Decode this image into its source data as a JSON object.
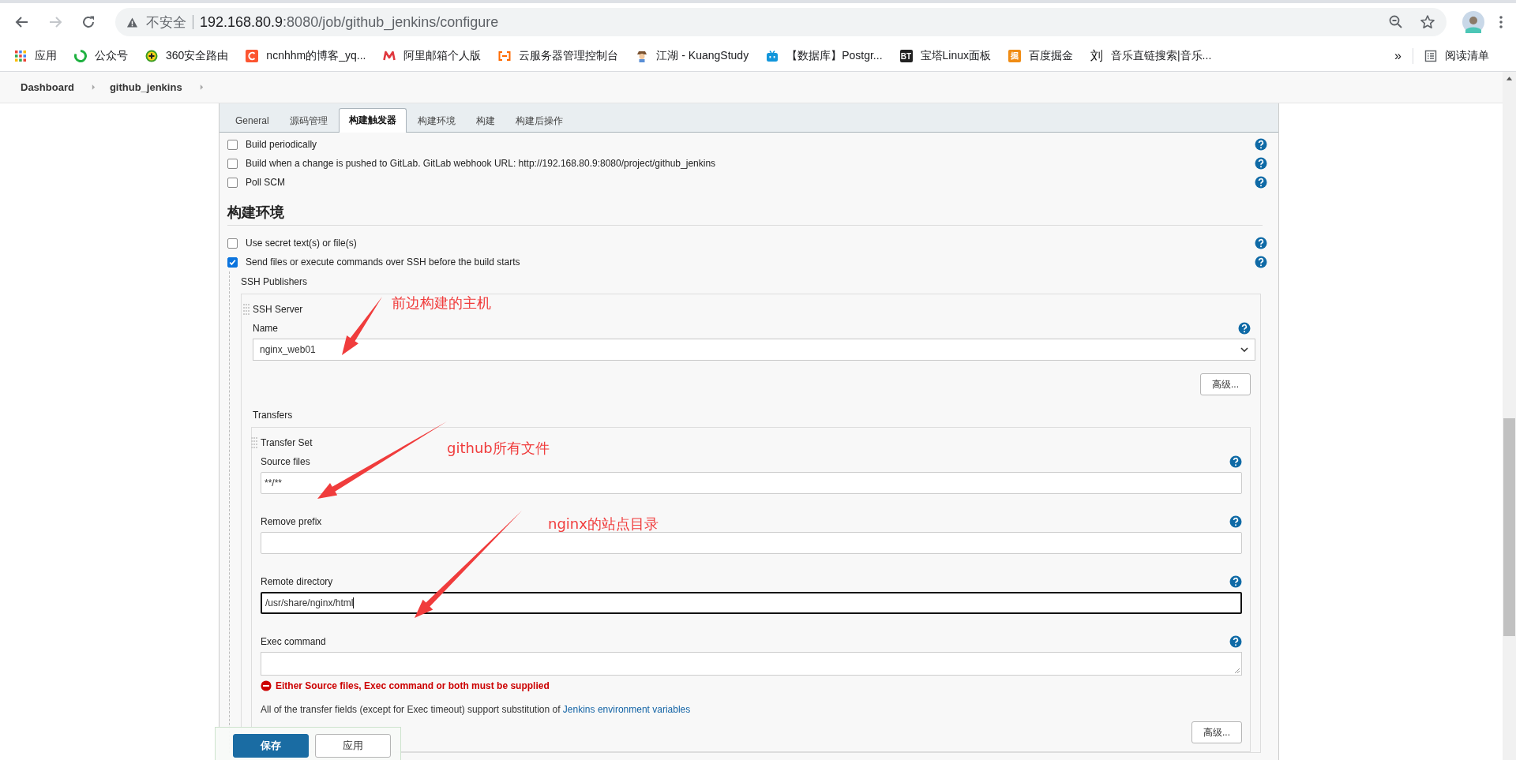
{
  "browser": {
    "security": "不安全",
    "url_host": "192.168.80.9",
    "url_path": ":8080/job/github_jenkins/configure",
    "forward_disabled": true,
    "bookmarks": [
      {
        "kind": "apps",
        "label": "应用"
      },
      {
        "kind": "ring",
        "label": "公众号"
      },
      {
        "kind": "plus",
        "label": "360安全路由"
      },
      {
        "kind": "c",
        "label": "ncnhhm的博客_yq..."
      },
      {
        "kind": "m",
        "label": "阿里邮箱个人版"
      },
      {
        "kind": "bracket",
        "label": "云服务器管理控制台"
      },
      {
        "kind": "figure",
        "label": "江湖 - KuangStudy"
      },
      {
        "kind": "tv",
        "label": "【数据库】Postgr..."
      },
      {
        "kind": "dark",
        "icon_text": "BT",
        "label": "宝塔Linux面板"
      },
      {
        "kind": "orange",
        "icon_text": "掘",
        "label": "百度掘金"
      },
      {
        "kind": "glyph",
        "icon_text": "刘",
        "label": "音乐直链搜索|音乐..."
      }
    ],
    "overflow": "»",
    "reading_list": "阅读清单"
  },
  "breadcrumbs": [
    "Dashboard",
    "github_jenkins"
  ],
  "tabs": [
    {
      "label": "General",
      "selected": false
    },
    {
      "label": "源码管理",
      "selected": false
    },
    {
      "label": "构建触发器",
      "selected": true
    },
    {
      "label": "构建环境",
      "selected": false
    },
    {
      "label": "构建",
      "selected": false
    },
    {
      "label": "构建后操作",
      "selected": false
    }
  ],
  "triggers": [
    {
      "label": "Build periodically",
      "checked": false
    },
    {
      "label": "Build when a change is pushed to GitLab. GitLab webhook URL: http://192.168.80.9:8080/project/github_jenkins",
      "checked": false
    },
    {
      "label": "Poll SCM",
      "checked": false
    }
  ],
  "section_title": "构建环境",
  "environment": [
    {
      "label": "Use secret text(s) or file(s)",
      "checked": false
    },
    {
      "label": "Send files or execute commands over SSH before the build starts",
      "checked": true
    }
  ],
  "ssh": {
    "title": "SSH Publishers",
    "server_title": "SSH Server",
    "name_label": "Name",
    "name_value": "nginx_web01",
    "advanced": "高级...",
    "transfers_title": "Transfers",
    "set_title": "Transfer Set",
    "fields": [
      {
        "kind": "input",
        "label": "Source files",
        "value": "**/**",
        "focused": false
      },
      {
        "kind": "input",
        "label": "Remove prefix",
        "focused": false
      },
      {
        "kind": "input",
        "label": "Remote directory",
        "value": "/usr/share/nginx/html",
        "focused": true
      },
      {
        "kind": "textarea",
        "label": "Exec command",
        "focused": false
      }
    ],
    "error": "Either Source files, Exec command or both must be supplied",
    "note": "All of the transfer fields (except for Exec timeout) support substitution of",
    "note_link": "Jenkins environment variables",
    "set_advanced": "高级..."
  },
  "actions": [
    {
      "label": "保存",
      "primary": true
    },
    {
      "label": "应用",
      "primary": false
    }
  ],
  "annotations": [
    {
      "text": "前边构建的主机"
    },
    {
      "text": "github所有文件"
    },
    {
      "text": "nginx的站点目录"
    }
  ]
}
